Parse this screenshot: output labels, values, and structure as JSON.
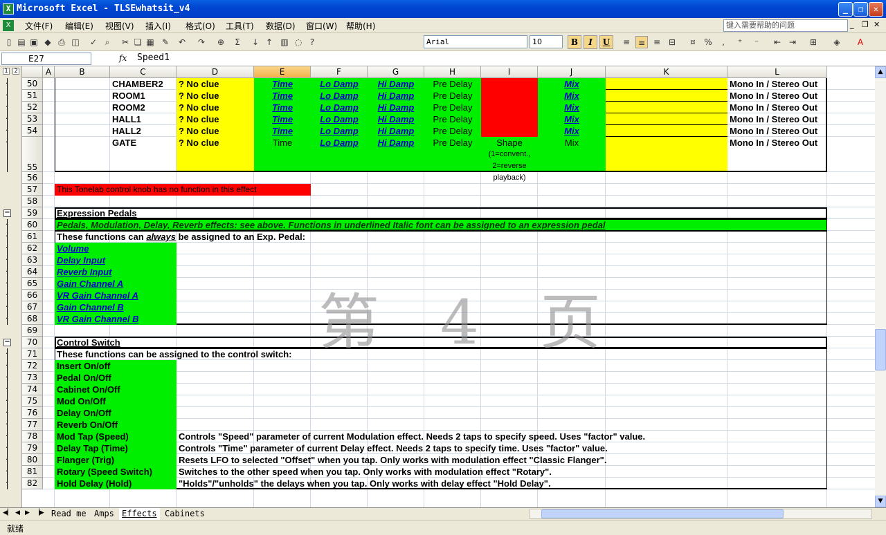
{
  "window": {
    "title": "Microsoft Excel - TLSEwhatsit_v4",
    "app_icon": "excel-icon"
  },
  "menu": [
    "文件(F)",
    "编辑(E)",
    "视图(V)",
    "插入(I)",
    "格式(O)",
    "工具(T)",
    "数据(D)",
    "窗口(W)",
    "帮助(H)"
  ],
  "help_placeholder": "键入需要帮助的问题",
  "toolbar": {
    "font": "Arial",
    "size": "10",
    "bold": "B",
    "italic": "I",
    "underline": "U"
  },
  "formula": {
    "cell": "E27",
    "fx": "fx",
    "value": "Speed1"
  },
  "columns": [
    "A",
    "B",
    "C",
    "D",
    "E",
    "F",
    "G",
    "H",
    "I",
    "J",
    "K",
    "L"
  ],
  "selected_column": "E",
  "rows": [
    "50",
    "51",
    "52",
    "53",
    "54",
    "55",
    "56",
    "57",
    "58",
    "59",
    "60",
    "61",
    "62",
    "63",
    "64",
    "65",
    "66",
    "67",
    "68",
    "69",
    "70",
    "71",
    "72",
    "73",
    "74",
    "75",
    "76",
    "77",
    "78",
    "79",
    "80",
    "81",
    "82"
  ],
  "cells": {
    "r50": {
      "c": "CHAMBER2",
      "d": "? No clue",
      "e": "Time",
      "f": "Lo Damp",
      "g": "Hi Damp",
      "h": "Pre Delay",
      "j": "Mix",
      "l": "Mono In / Stereo Out"
    },
    "r51": {
      "c": "ROOM1",
      "d": "? No clue",
      "e": "Time",
      "f": "Lo Damp",
      "g": "Hi Damp",
      "h": "Pre Delay",
      "j": "Mix",
      "l": "Mono In / Stereo Out"
    },
    "r52": {
      "c": "ROOM2",
      "d": "? No clue",
      "e": "Time",
      "f": "Lo Damp",
      "g": "Hi Damp",
      "h": "Pre Delay",
      "j": "Mix",
      "l": "Mono In / Stereo Out"
    },
    "r53": {
      "c": "HALL1",
      "d": "? No clue",
      "e": "Time",
      "f": "Lo Damp",
      "g": "Hi Damp",
      "h": "Pre Delay",
      "j": "Mix",
      "l": "Mono In / Stereo Out"
    },
    "r54": {
      "c": "HALL2",
      "d": "? No clue",
      "e": "Time",
      "f": "Lo Damp",
      "g": "Hi Damp",
      "h": "Pre Delay",
      "j": "Mix",
      "l": "Mono In / Stereo Out"
    },
    "r55": {
      "c": "GATE",
      "d": "? No clue",
      "e": "Time",
      "f": "Lo Damp",
      "g": "Hi Damp",
      "h": "Pre Delay",
      "i1": "Shape",
      "i2": "(1=convent.,",
      "i3": "2=reverse",
      "i4": "playback)",
      "j": "Mix",
      "l": "Mono In / Stereo Out"
    },
    "r57": "This Tonelab control knob has no function in this effect",
    "r59": "Expression Pedals",
    "r60": "Pedals, Modulation, Delay, Reverb effects: see above. Functions in underlined Italic font can be assigned to an expression pedal",
    "r61a": "These functions can ",
    "r61b": "always",
    "r61c": " be assigned to an Exp. Pedal:",
    "r62": "Volume",
    "r63": "Delay Input",
    "r64": "Reverb Input",
    "r65": "Gain Channel A",
    "r66": "VR Gain Channel A",
    "r67": "Gain Channel B",
    "r68": "VR Gain Channel B",
    "r70": "Control Switch",
    "r71": "These functions can be assigned to the control switch:",
    "r72": "Insert On/off",
    "r73": "Pedal On/Off",
    "r74": "Cabinet On/Off",
    "r75": "Mod On/Off",
    "r76": "Delay On/Off",
    "r77": "Reverb On/Off",
    "r78b": "Mod Tap (Speed)",
    "r78d": "Controls \"Speed\" parameter of current Modulation effect. Needs 2 taps to specify speed. Uses \"factor\" value.",
    "r79b": "Delay Tap (Time)",
    "r79d": "Controls \"Time\" parameter of current Delay effect. Needs 2 taps to specify time. Uses \"factor\" value.",
    "r80b": "Flanger (Trig)",
    "r80d": "Resets LFO to selected \"Offset\" when you tap. Only works with modulation effect \"Classic Flanger\".",
    "r81b": "Rotary (Speed Switch)",
    "r81d": "Switches to the other speed when you tap. Only works with modulation effect \"Rotary\".",
    "r82b": "Hold Delay (Hold)",
    "r82d": "\"Holds\"/\"unholds\" the delays when you tap. Only works with delay effect \"Hold Delay\"."
  },
  "watermark": "第 4 页",
  "sheets": [
    "Read me",
    "Amps",
    "Effects",
    "Cabinets"
  ],
  "active_sheet": "Effects",
  "status": "就绪",
  "colors": {
    "green": "#00ee00",
    "yellow": "#ffff00",
    "red": "#ff0000",
    "link": "#0000cc"
  }
}
